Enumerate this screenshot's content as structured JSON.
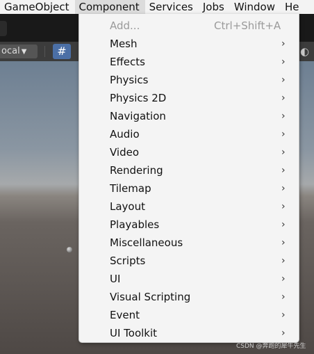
{
  "menubar": {
    "items": [
      "GameObject",
      "Component",
      "Services",
      "Jobs",
      "Window",
      "He"
    ]
  },
  "toolbar": {
    "pivot_mode": "ocal",
    "caret": "▼",
    "grid_icon": "#"
  },
  "component_menu": {
    "add": {
      "label": "Add...",
      "shortcut": "Ctrl+Shift+A"
    },
    "chevron": "›",
    "items": [
      "Mesh",
      "Effects",
      "Physics",
      "Physics 2D",
      "Navigation",
      "Audio",
      "Video",
      "Rendering",
      "Tilemap",
      "Layout",
      "Playables",
      "Miscellaneous",
      "Scripts",
      "UI",
      "Visual Scripting",
      "Event",
      "UI Toolkit"
    ]
  },
  "watermark": "CSDN @奔跑的犀牛先生"
}
